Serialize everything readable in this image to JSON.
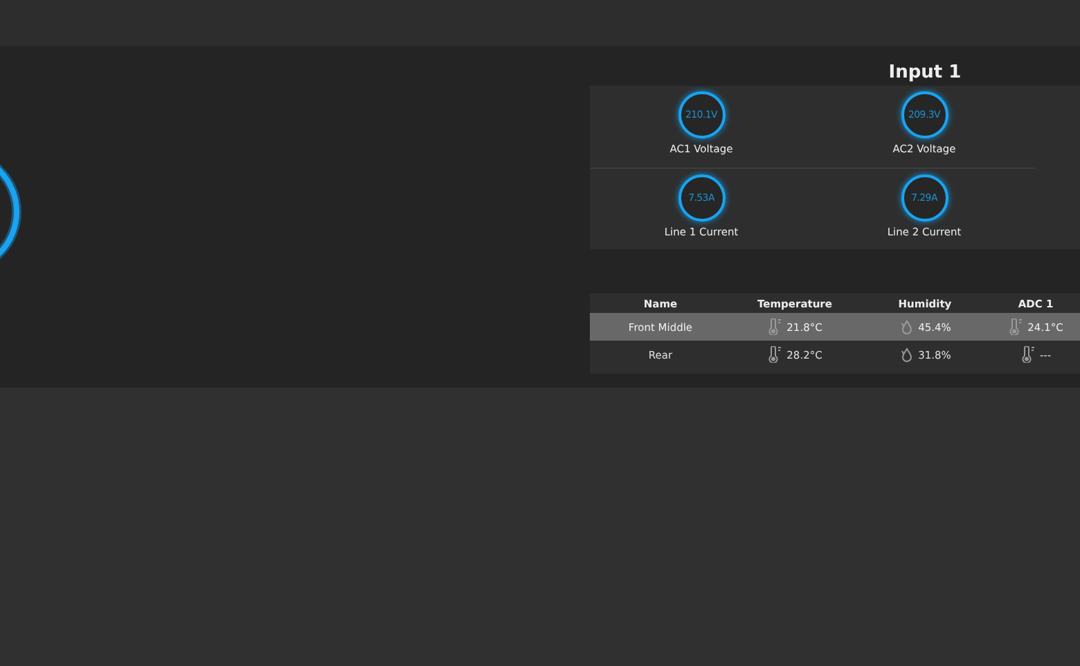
{
  "panel": {
    "title": "Input 1",
    "gauges": [
      {
        "value": "210.1V",
        "label": "AC1 Voltage"
      },
      {
        "value": "209.3V",
        "label": "AC2 Voltage"
      },
      {
        "value": "7.53A",
        "label": "Line 1 Current"
      },
      {
        "value": "7.29A",
        "label": "Line 2 Current"
      }
    ]
  },
  "table": {
    "columns": [
      "Name",
      "Temperature",
      "Humidity",
      "ADC 1"
    ],
    "rows": [
      {
        "selected": true,
        "name": "Front Middle",
        "temperature": "21.8°C",
        "humidity": "45.4%",
        "adc_1": "24.1°C"
      },
      {
        "selected": false,
        "name": "Rear",
        "temperature": "28.2°C",
        "humidity": "31.8%",
        "adc_1": "---"
      }
    ]
  }
}
